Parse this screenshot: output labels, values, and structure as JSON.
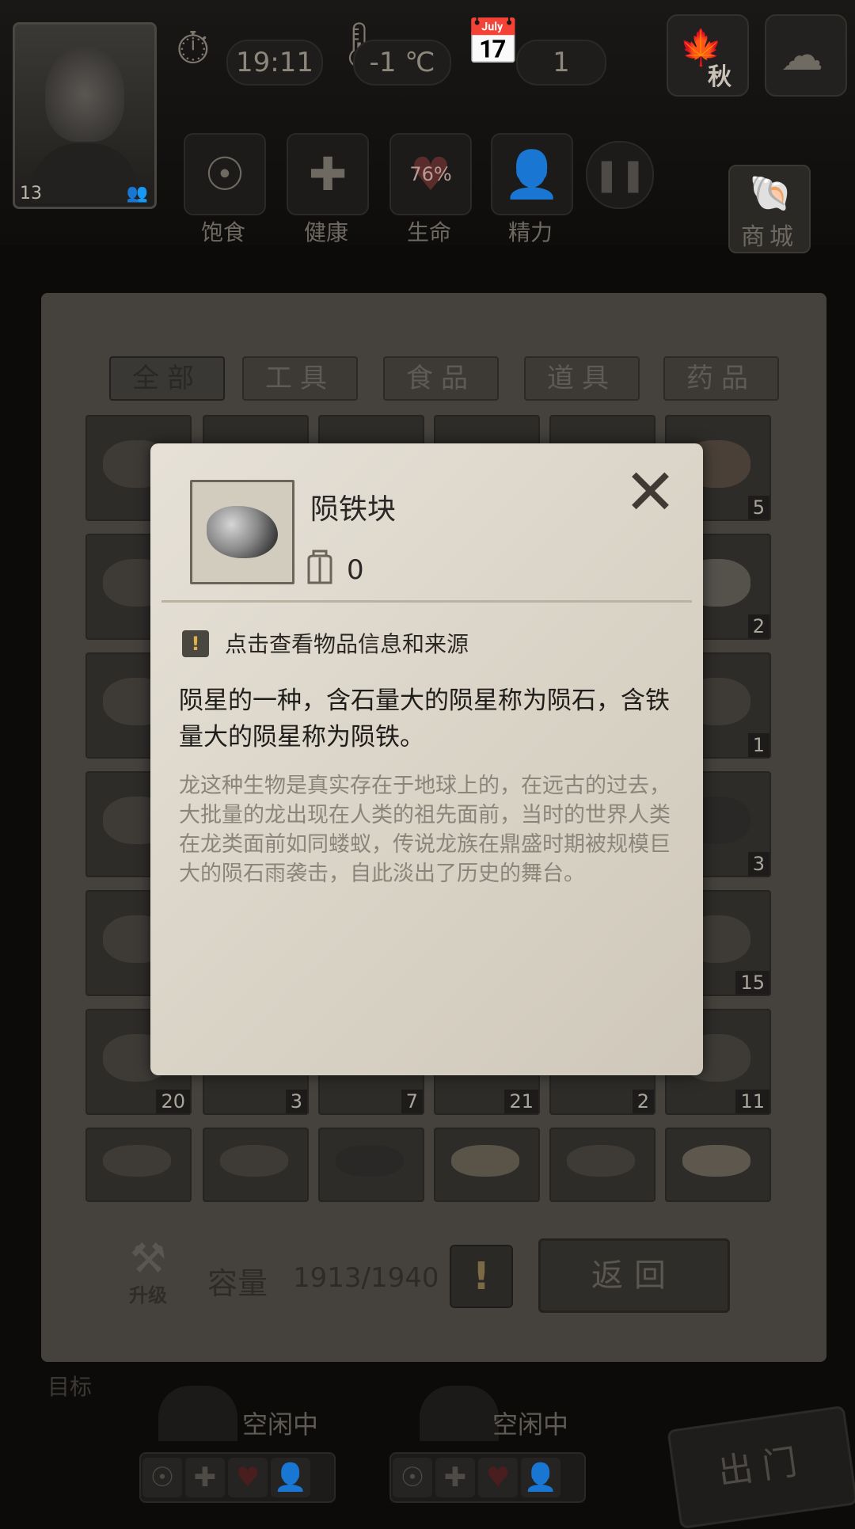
{
  "hud": {
    "time": "19:11",
    "temperature": "-1 ℃",
    "day": "1",
    "season": "秋",
    "level": "13",
    "stats": [
      {
        "label": "饱食",
        "icon": "stomach-icon"
      },
      {
        "label": "健康",
        "icon": "cross-icon"
      },
      {
        "label": "生命",
        "icon": "heart-icon",
        "value": "76%"
      },
      {
        "label": "精力",
        "icon": "person-icon"
      }
    ],
    "shop_label": "商城"
  },
  "inventory": {
    "tabs": [
      "全部",
      "工具",
      "食品",
      "道具",
      "药品"
    ],
    "active_tab": "全部",
    "visible_counts": [
      "5",
      "2",
      "1",
      "3",
      "15",
      "11",
      "20",
      "3",
      "7",
      "21",
      "2"
    ],
    "upgrade_label": "升级",
    "capacity_label": "容量",
    "capacity_value": "1913/1940",
    "back_label": "返回"
  },
  "workers": [
    {
      "status": "空闲中"
    },
    {
      "status": "空闲中"
    }
  ],
  "target_label": "目标",
  "exit_label": "出门",
  "dialog": {
    "item_name": "陨铁块",
    "item_count": "0",
    "hint": "点击查看物品信息和来源",
    "description": "陨星的一种，含石量大的陨星称为陨石，含铁量大的陨星称为陨铁。",
    "lore": "龙这种生物是真实存在于地球上的，在远古的过去，大批量的龙出现在人类的祖先面前，当时的世界人类在龙类面前如同蝼蚁，传说龙族在鼎盛时期被规模巨大的陨石雨袭击，自此淡出了历史的舞台。"
  }
}
